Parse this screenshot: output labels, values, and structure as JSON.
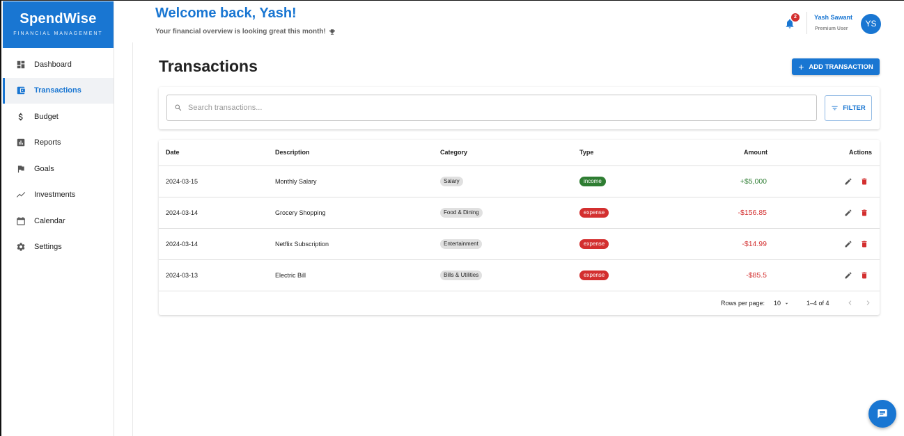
{
  "brand": {
    "name": "SpendWise",
    "tagline": "FINANCIAL MANAGEMENT",
    "accent": "#1976d2"
  },
  "sidebar": {
    "items": [
      {
        "label": "Dashboard",
        "icon": "dashboard-icon"
      },
      {
        "label": "Transactions",
        "icon": "wallet-icon",
        "active": true
      },
      {
        "label": "Budget",
        "icon": "dollar-icon"
      },
      {
        "label": "Reports",
        "icon": "bar-chart-icon"
      },
      {
        "label": "Goals",
        "icon": "flag-icon"
      },
      {
        "label": "Investments",
        "icon": "trending-line-icon"
      },
      {
        "label": "Calendar",
        "icon": "calendar-icon"
      },
      {
        "label": "Settings",
        "icon": "gear-icon"
      }
    ]
  },
  "header": {
    "welcome": "Welcome back, Yash!",
    "subtitle": "Your financial overview is looking great this month!",
    "notifications_count": "2",
    "user_name": "Yash Sawant",
    "user_role": "Premium User",
    "avatar_initials": "YS"
  },
  "page": {
    "title": "Transactions",
    "add_button": "ADD TRANSACTION"
  },
  "search": {
    "placeholder": "Search transactions...",
    "value": "",
    "filter_label": "FILTER"
  },
  "table": {
    "headers": {
      "date": "Date",
      "description": "Description",
      "category": "Category",
      "type": "Type",
      "amount": "Amount",
      "actions": "Actions"
    },
    "rows": [
      {
        "date": "2024-03-15",
        "description": "Monthly Salary",
        "category": "Salary",
        "type": "income",
        "amount": "+$5,000"
      },
      {
        "date": "2024-03-14",
        "description": "Grocery Shopping",
        "category": "Food & Dining",
        "type": "expense",
        "amount": "-$156.85"
      },
      {
        "date": "2024-03-14",
        "description": "Netflix Subscription",
        "category": "Entertainment",
        "type": "expense",
        "amount": "-$14.99"
      },
      {
        "date": "2024-03-13",
        "description": "Electric Bill",
        "category": "Bills & Utilities",
        "type": "expense",
        "amount": "-$85.5"
      }
    ],
    "footer": {
      "rows_per_page_label": "Rows per page:",
      "rows_per_page": "10",
      "range": "1–4 of 4"
    }
  },
  "colors": {
    "income": "#2e7d32",
    "expense": "#d32f2f",
    "income_text": "#2e7d32",
    "expense_text": "#d32f2f"
  }
}
